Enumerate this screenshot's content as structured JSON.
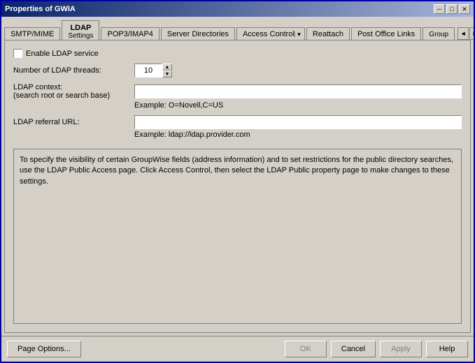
{
  "window": {
    "title": "Properties of GWIA"
  },
  "tabs": [
    {
      "id": "smtp-mime",
      "label": "SMTP/MIME",
      "active": false
    },
    {
      "id": "ldap",
      "label": "LDAP",
      "active": true,
      "sublabel": "Settings"
    },
    {
      "id": "pop3-imap4",
      "label": "POP3/IMAP4",
      "active": false
    },
    {
      "id": "server-directories",
      "label": "Server Directories",
      "active": false
    },
    {
      "id": "access-control",
      "label": "Access Control",
      "active": false,
      "has_dropdown": true
    },
    {
      "id": "reattach",
      "label": "Reattach",
      "active": false
    },
    {
      "id": "post-office-links",
      "label": "Post Office Links",
      "active": false
    },
    {
      "id": "group",
      "label": "Group",
      "active": false
    }
  ],
  "content": {
    "enable_ldap_label": "Enable LDAP service",
    "threads_label": "Number of LDAP threads:",
    "threads_value": "10",
    "context_label": "LDAP context:",
    "context_sublabel": "(search root or search base)",
    "context_placeholder": "",
    "context_example": "Example: O=Novell,C=US",
    "referral_label": "LDAP referral URL:",
    "referral_placeholder": "",
    "referral_example": "Example: ldap://ldap.provider.com",
    "info_text": "To specify the visibility of certain GroupWise fields (address information) and to set restrictions for the public directory searches, use the LDAP Public Access page. Click Access Control, then select the LDAP Public property page to make changes to these settings."
  },
  "buttons": {
    "page_options": "Page Options...",
    "ok": "OK",
    "cancel": "Cancel",
    "apply": "Apply",
    "help": "Help"
  },
  "icons": {
    "close": "✕",
    "minimize": "─",
    "maximize": "□",
    "arrow_up": "▲",
    "arrow_down": "▼",
    "nav_left": "◄",
    "nav_right": "►"
  }
}
